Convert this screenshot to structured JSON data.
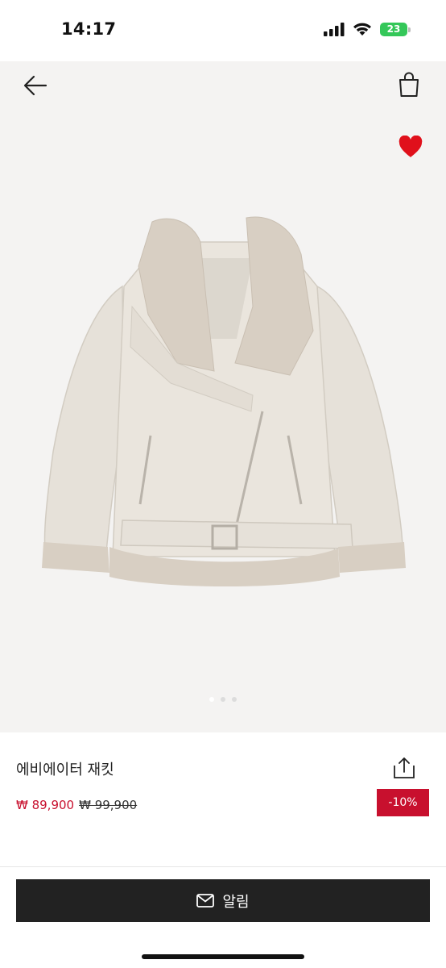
{
  "status_bar": {
    "time": "14:17",
    "battery": "23"
  },
  "nav": {
    "back_icon": "back-arrow-icon",
    "bag_icon": "shopping-bag-icon",
    "favorite_icon": "heart-icon"
  },
  "product": {
    "name": "에비에이터 재킷",
    "sale_price": "₩ 89,900",
    "original_price": "₩ 99,900",
    "discount": "-10%",
    "image_pages": 3,
    "current_image": 1
  },
  "actions": {
    "notify_label": "알림",
    "notify_icon": "mail-icon",
    "share_icon": "share-icon"
  },
  "colors": {
    "accent_red": "#c8102e",
    "button_dark": "#222222",
    "image_bg": "#f4f3f2",
    "heart": "#e0101b"
  }
}
